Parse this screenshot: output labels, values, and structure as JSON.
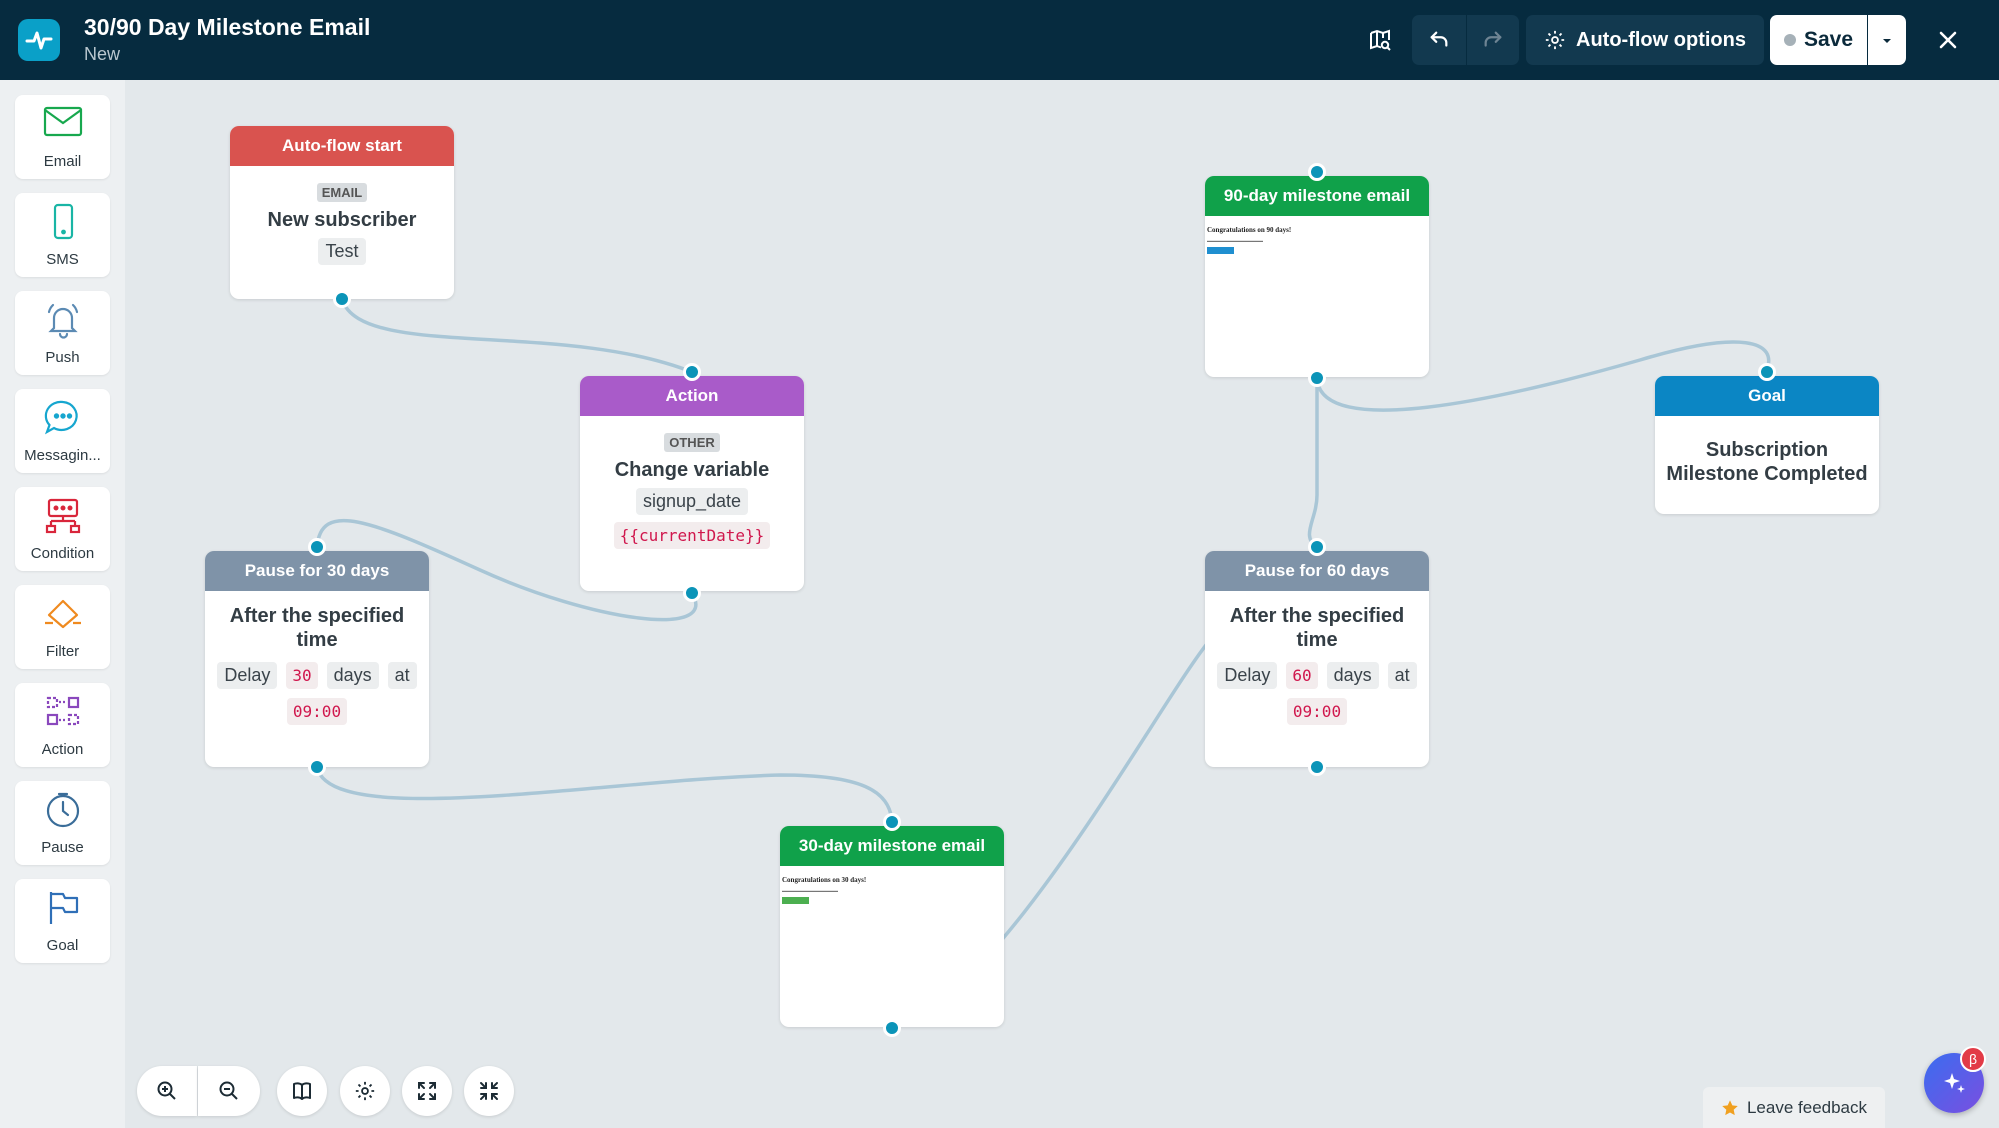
{
  "app": {
    "title": "30/90 Day Milestone Email",
    "status": "New"
  },
  "toolbar": {
    "options_label": "Auto-flow options",
    "save_label": "Save"
  },
  "sidebar": {
    "items": [
      {
        "label": "Email",
        "icon": "envelope-icon"
      },
      {
        "label": "SMS",
        "icon": "phone-icon"
      },
      {
        "label": "Push",
        "icon": "bell-icon"
      },
      {
        "label": "Messagin...",
        "icon": "chat-bubble-icon"
      },
      {
        "label": "Condition",
        "icon": "condition-icon"
      },
      {
        "label": "Filter",
        "icon": "filter-icon"
      },
      {
        "label": "Action",
        "icon": "action-icon"
      },
      {
        "label": "Pause",
        "icon": "clock-icon"
      },
      {
        "label": "Goal",
        "icon": "flag-icon"
      }
    ]
  },
  "nodes": {
    "start": {
      "header": "Auto-flow start",
      "tag": "EMAIL",
      "title": "New subscriber",
      "chip": "Test",
      "color": "#d9534f"
    },
    "action": {
      "header": "Action",
      "tag": "OTHER",
      "title": "Change variable",
      "chip": "signup_date",
      "code": "{{currentDate}}",
      "color": "#a95bc9"
    },
    "pause30": {
      "header": "Pause for 30 days",
      "title": "After the specified time",
      "delay_label": "Delay",
      "delay_value": "30",
      "unit": "days",
      "at_label": "at",
      "time": "09:00",
      "color": "#7f93a8"
    },
    "email30": {
      "header": "30-day milestone email",
      "preview_heading": "Congratulations on 30 days!",
      "color": "#10a14a"
    },
    "email90": {
      "header": "90-day milestone email",
      "preview_heading": "Congratulations on 90 days!",
      "color": "#10a14a"
    },
    "pause60": {
      "header": "Pause for 60 days",
      "title": "After the specified time",
      "delay_label": "Delay",
      "delay_value": "60",
      "unit": "days",
      "at_label": "at",
      "time": "09:00",
      "color": "#7f93a8"
    },
    "goal": {
      "header": "Goal",
      "title": "Subscription Milestone Completed",
      "color": "#0b86c4"
    }
  },
  "footer": {
    "feedback_label": "Leave feedback",
    "beta_badge": "β"
  },
  "colors": {
    "topbar": "#062b3f",
    "canvas": "#e3e8eb",
    "connector": "#0b94b8",
    "edge": "#a9c6d6"
  }
}
